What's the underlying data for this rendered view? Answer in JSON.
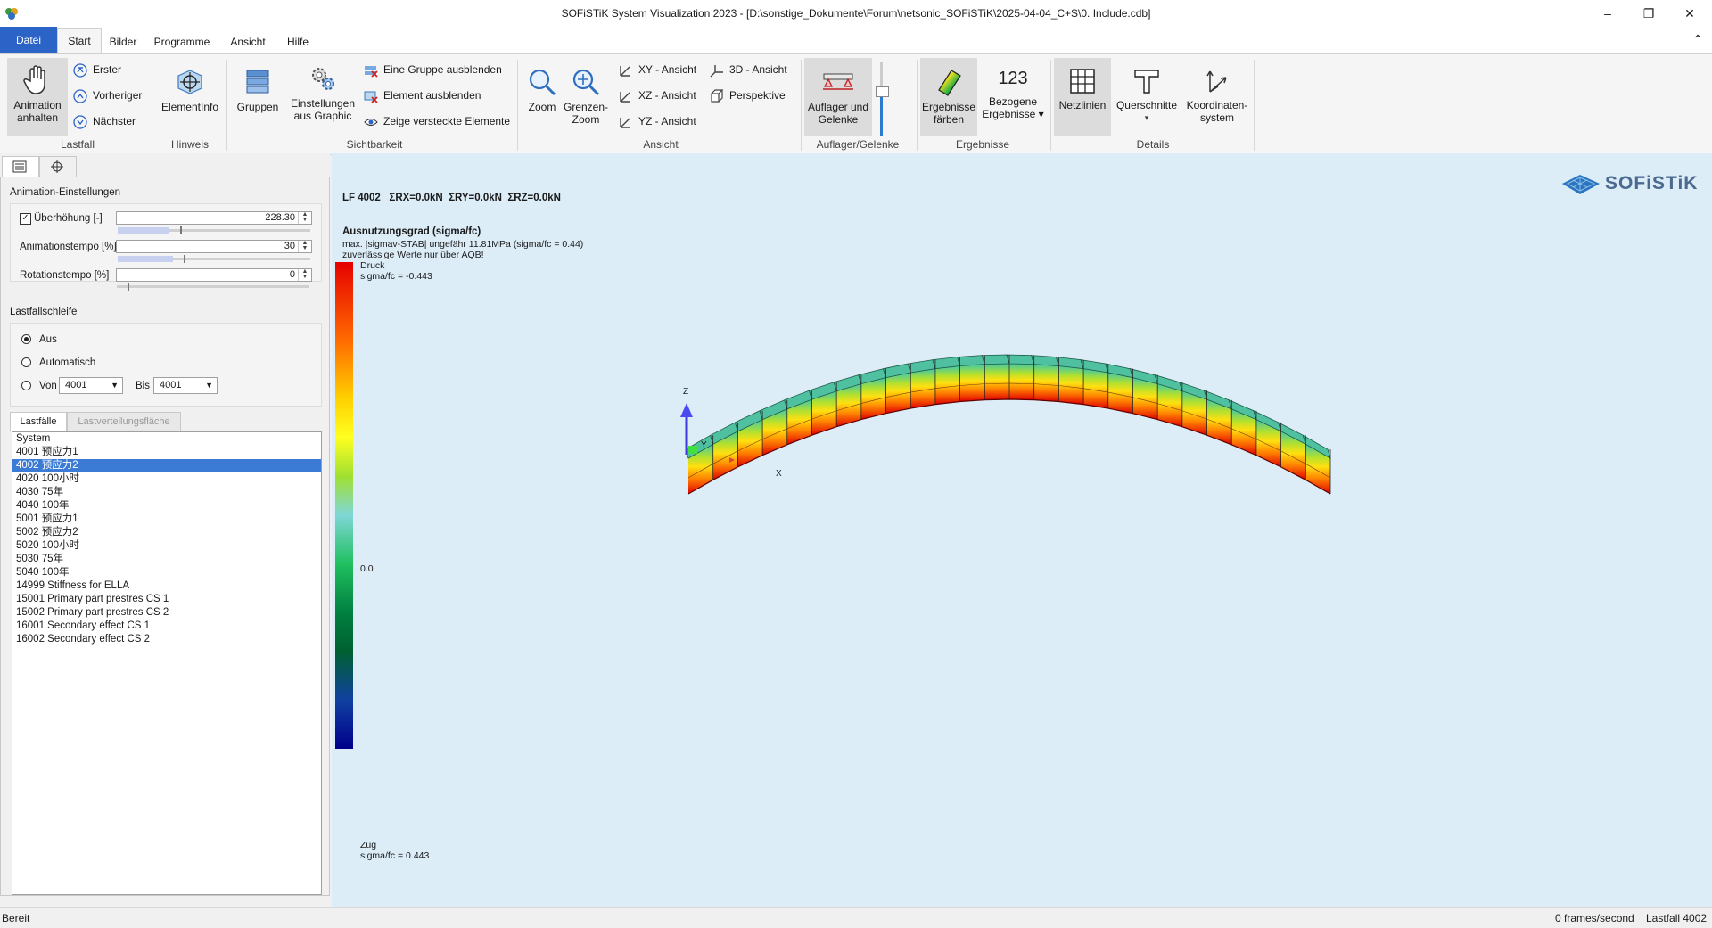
{
  "window": {
    "title": "SOFiSTiK System Visualization 2023 - [D:\\sonstige_Dokumente\\Forum\\netsonic_SOFiSTiK\\2025-04-04_C+S\\0. Include.cdb]",
    "minimize": "–",
    "restore": "❐",
    "close": "✕"
  },
  "menu": {
    "items": [
      "Datei",
      "Start",
      "Bilder",
      "Programme",
      "Ansicht",
      "Hilfe"
    ],
    "collapse": "⌃"
  },
  "ribbon": {
    "lastfall": {
      "animation_btn": "Animation\nanhalten",
      "erster": "Erster",
      "vorheriger": "Vorheriger",
      "naechster": "Nächster",
      "label": "Lastfall"
    },
    "hinweis": {
      "elementinfo": "ElementInfo",
      "label": "Hinweis"
    },
    "sichtbarkeit": {
      "gruppen": "Gruppen",
      "einstellungen": "Einstellungen\naus Graphic",
      "eine_gruppe": "Eine Gruppe ausblenden",
      "element": "Element ausblenden",
      "zeige": "Zeige versteckte Elemente",
      "label": "Sichtbarkeit"
    },
    "ansicht": {
      "zoom": "Zoom",
      "grenzen_zoom": "Grenzen-\nZoom",
      "xy": "XY - Ansicht",
      "xz": "XZ - Ansicht",
      "yz": "YZ - Ansicht",
      "d3": "3D - Ansicht",
      "perspektive": "Perspektive",
      "label": "Ansicht"
    },
    "auflager": {
      "btn": "Auflager und\nGelenke",
      "label": "Auflager/Gelenke"
    },
    "ergebnisse": {
      "faerben": "Ergebnisse\nfärben",
      "bezogene_icon": "123",
      "bezogene": "Bezogene\nErgebnisse ▾",
      "label": "Ergebnisse"
    },
    "details": {
      "netzlinien": "Netzlinien",
      "querschnitte": "Querschnitte",
      "koordinaten": "Koordinaten-\nsystem",
      "label": "Details"
    }
  },
  "panel": {
    "animation": {
      "title": "Animation-Einstellungen",
      "ueberhoehung_label": "Überhöhung [-]",
      "ueberhoehung_value": "228.30",
      "ueberhoehung_checked": true,
      "tempo_label": "Animationstempo [%]",
      "tempo_value": "30",
      "rotation_label": "Rotationstempo [%]",
      "rotation_value": "0"
    },
    "schleife": {
      "title": "Lastfallschleife",
      "aus": "Aus",
      "automatisch": "Automatisch",
      "von": "Von",
      "von_value": "4001",
      "bis": "Bis",
      "bis_value": "4001",
      "selected": "aus"
    },
    "tabs": [
      "Lastfälle",
      "Lastverteilungsfläche"
    ],
    "loadcases": [
      "System",
      "4001 预应力1",
      "4002 预应力2",
      "4020 100小时",
      "4030 75年",
      "4040 100年",
      "5001 预应力1",
      "5002 预应力2",
      "5020 100小时",
      "5030 75年",
      "5040 100年",
      "14999 Stiffness for ELLA",
      "15001 Primary part prestres CS  1",
      "15002 Primary part prestres CS  2",
      "16001 Secondary effect CS  1",
      "16002 Secondary effect CS  2"
    ],
    "selected_index": 2
  },
  "viewport": {
    "header": "LF 4002   ΣRX=0.0kN  ΣRY=0.0kN  ΣRZ=0.0kN",
    "result_title": "Ausnutzungsgrad (sigma/fc)",
    "result_line1": "max. |sigmav-STAB| ungefähr 11.81MPa (sigma/fc = 0.44)",
    "result_line2": "zuverlässige Werte nur über AQB!",
    "druck": "Druck",
    "druck_value": "sigma/fc = -0.443",
    "zero": "0.0",
    "zug": "Zug",
    "zug_value": "sigma/fc = 0.443",
    "logo": "SOFiSTiK",
    "axis_x": "X",
    "axis_y": "Y",
    "axis_z": "Z",
    "colors": {
      "background": "#dcedf8",
      "legend_top": "#e60000",
      "legend_mid": "#7fd6d6",
      "legend_bottom": "#00008b",
      "beam_top": "#3fb58a"
    }
  },
  "status": {
    "left": "Bereit",
    "frames": "0 frames/second",
    "lastfall": "Lastfall 4002"
  }
}
